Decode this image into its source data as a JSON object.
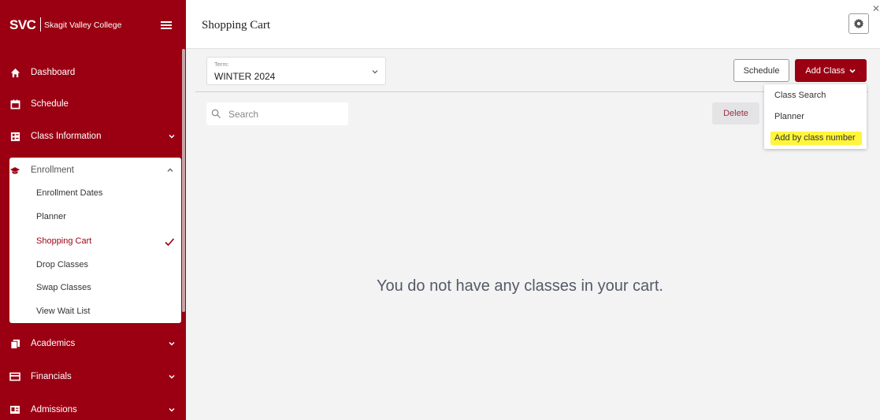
{
  "app": {
    "logo_text": "SVC",
    "college_name": "Skagit Valley College",
    "brand_color": "#9a0012"
  },
  "sidebar": {
    "items": [
      {
        "label": "Dashboard",
        "icon": "home-icon"
      },
      {
        "label": "Schedule",
        "icon": "calendar-icon"
      },
      {
        "label": "Class Information",
        "icon": "info-card-icon",
        "expandable": true
      },
      {
        "label": "Academics",
        "icon": "documents-icon",
        "expandable": true
      },
      {
        "label": "Financials",
        "icon": "credit-card-icon",
        "expandable": true
      },
      {
        "label": "Admissions",
        "icon": "id-card-icon",
        "expandable": true
      }
    ],
    "enrollment": {
      "label": "Enrollment",
      "icon": "graduation-cap-icon",
      "expanded": true,
      "sub_items": [
        {
          "label": "Enrollment Dates"
        },
        {
          "label": "Planner"
        },
        {
          "label": "Shopping Cart",
          "active": true
        },
        {
          "label": "Drop Classes"
        },
        {
          "label": "Swap Classes"
        },
        {
          "label": "View Wait List"
        }
      ]
    }
  },
  "header": {
    "title": "Shopping Cart"
  },
  "term": {
    "label": "Term:",
    "value": "WINTER 2024"
  },
  "toolbar": {
    "schedule_label": "Schedule",
    "add_class_label": "Add Class",
    "delete_label": "Delete"
  },
  "search": {
    "placeholder": "Search"
  },
  "add_class_menu": {
    "items": [
      {
        "label": "Class Search"
      },
      {
        "label": "Planner"
      },
      {
        "label": "Add by class number",
        "highlighted": true
      }
    ]
  },
  "main": {
    "empty_message": "You do not have any classes in your cart."
  }
}
